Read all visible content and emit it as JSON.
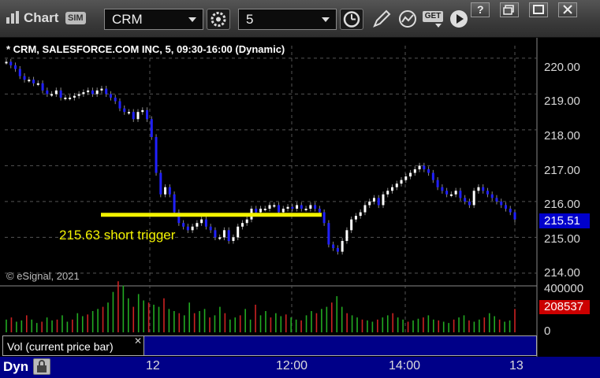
{
  "toolbar": {
    "title": "Chart",
    "sim_badge": "SIM",
    "symbol": "CRM",
    "interval": "5",
    "get_label": "GET"
  },
  "chart": {
    "header": "* CRM, SALESFORCE.COM INC, 5, 09:30-16:00 (Dynamic)",
    "copyright": "© eSignal, 2021",
    "annotation": "215.63 short trigger",
    "current_price": "215.51",
    "current_volume": "208537",
    "volume_study_label": "Vol (current price bar)",
    "volume_axis": [
      "400000",
      "0"
    ],
    "bottom_label": "Dyn",
    "x_labels": [
      "12",
      "12:00",
      "14:00",
      "13"
    ],
    "colors": {
      "up": "#ffffff",
      "down": "#2020ff",
      "trigger": "#f2f200",
      "vol_up": "#22aa22",
      "vol_down": "#cc2222"
    }
  },
  "chart_data": {
    "type": "line",
    "title": "* CRM, SALESFORCE.COM INC, 5, 09:30-16:00 (Dynamic)",
    "y_ticks": [
      "220.00",
      "219.00",
      "218.00",
      "217.00",
      "216.00",
      "215.00",
      "214.00"
    ],
    "ylim": [
      213.8,
      220.35
    ],
    "x": [
      0,
      1,
      2,
      3,
      4,
      5,
      6,
      7,
      8,
      9,
      10,
      11,
      12,
      13,
      14,
      15,
      16,
      17,
      18,
      19,
      20,
      21,
      22,
      23,
      24,
      25,
      26,
      27,
      28,
      29,
      30,
      31,
      32,
      33,
      34,
      35,
      36,
      37,
      38,
      39,
      40,
      41,
      42,
      43,
      44,
      45,
      46,
      47,
      48,
      49,
      50,
      51,
      52,
      53,
      54,
      55,
      56,
      57,
      58,
      59,
      60,
      61,
      62,
      63,
      64,
      65,
      66,
      67,
      68,
      69,
      70,
      71,
      72,
      73,
      74,
      75,
      76,
      77,
      78,
      79,
      80,
      81,
      82,
      83,
      84,
      85,
      86,
      87,
      88,
      89,
      90,
      91,
      92,
      93,
      94,
      95,
      96,
      97,
      98,
      99,
      100,
      101,
      102,
      103,
      104,
      105,
      106,
      107,
      108,
      109,
      110,
      111,
      112,
      113,
      114,
      115,
      116,
      117,
      118,
      119,
      120,
      121,
      122,
      123,
      124,
      125,
      126,
      127,
      128,
      129,
      130,
      131,
      132,
      133,
      134,
      135,
      136,
      137,
      138,
      139,
      140,
      141,
      142,
      143,
      144,
      145,
      146,
      147,
      148,
      149,
      150,
      151,
      152,
      153,
      154,
      155,
      156,
      157,
      158,
      159,
      160,
      161,
      162,
      163,
      164,
      165,
      166,
      167,
      168,
      169,
      170,
      171,
      172
    ],
    "series": [
      {
        "values": [
          219.9,
          219.8,
          219.7,
          219.5,
          219.4,
          219.4,
          219.3,
          219.3,
          219.1,
          219.0,
          219.0,
          219.1,
          218.9,
          218.9,
          218.9,
          218.95,
          219.0,
          219.05,
          219.1,
          219.0,
          219.1,
          219.15,
          219.0,
          218.9,
          218.8,
          218.6,
          218.5,
          218.5,
          218.3,
          218.5,
          218.55,
          218.3,
          217.8,
          216.8,
          216.2,
          216.4,
          216.2,
          215.7,
          215.4,
          215.3,
          215.2,
          215.3,
          215.4,
          215.5,
          215.3,
          215.2,
          215.0,
          215.0,
          215.2,
          214.9,
          215.0,
          215.3,
          215.4,
          215.5,
          215.8,
          215.7,
          215.8,
          215.8,
          215.9,
          215.9,
          215.7,
          215.8,
          215.85,
          215.8,
          215.9,
          215.8,
          215.8,
          215.9,
          215.8,
          215.7,
          215.4,
          214.8,
          214.7,
          214.6,
          214.9,
          215.2,
          215.5,
          215.6,
          215.7,
          215.9,
          216.0,
          216.1,
          215.9,
          216.2,
          216.3,
          216.4,
          216.5,
          216.6,
          216.7,
          216.8,
          216.9,
          217.0,
          216.9,
          216.8,
          216.6,
          216.4,
          216.3,
          216.2,
          216.2,
          216.3,
          216.1,
          216.0,
          215.9,
          216.3,
          216.4,
          216.3,
          216.2,
          216.1,
          216.0,
          215.9,
          215.8,
          215.7,
          215.5
        ],
        "volumes": [
          30,
          35,
          25,
          28,
          40,
          30,
          22,
          25,
          35,
          28,
          30,
          40,
          25,
          30,
          45,
          38,
          42,
          50,
          55,
          60,
          70,
          95,
          120,
          110,
          80,
          60,
          90,
          75,
          70,
          65,
          60,
          80,
          55,
          50,
          45,
          40,
          70,
          45,
          50,
          55,
          35,
          40,
          60,
          45,
          30,
          35,
          40,
          55,
          30,
          65,
          40,
          50,
          35,
          45,
          38,
          42,
          35,
          30,
          28,
          40,
          50,
          45,
          55,
          60,
          70,
          85,
          60,
          45,
          40,
          35,
          30,
          28,
          25,
          30,
          35,
          40,
          45,
          35,
          30,
          25,
          28,
          32,
          35,
          40,
          30,
          28,
          25,
          22,
          30,
          35,
          40,
          28,
          25,
          30,
          35,
          45,
          38,
          30,
          25,
          28,
          55
        ]
      }
    ],
    "trigger_level": 215.63
  }
}
